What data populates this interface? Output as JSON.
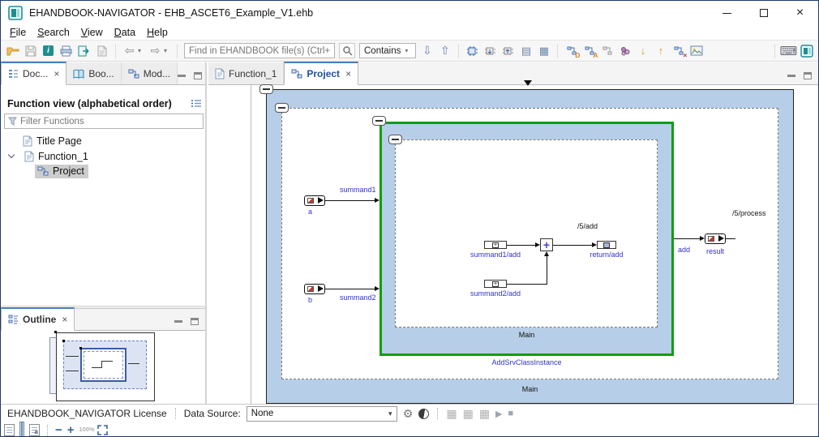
{
  "window": {
    "title": "EHANDBOOK-NAVIGATOR - EHB_ASCET6_Example_V1.ehb"
  },
  "menu": {
    "items": [
      "File",
      "Search",
      "View",
      "Data",
      "Help"
    ]
  },
  "toolbar": {
    "find_placeholder": "Find in EHANDBOOK file(s) (Ctrl+H)",
    "contains_label": "Contains"
  },
  "left_panel": {
    "tabs": [
      {
        "label": "Doc..."
      },
      {
        "label": "Boo..."
      },
      {
        "label": "Mod..."
      }
    ],
    "header": "Function view (alphabetical order)",
    "filter_placeholder": "Filter Functions",
    "tree": [
      {
        "label": "Title Page"
      },
      {
        "label": "Function_1"
      },
      {
        "label": "Project"
      }
    ]
  },
  "outline": {
    "title": "Outline"
  },
  "editor": {
    "tabs": [
      {
        "label": "Function_1"
      },
      {
        "label": "Project"
      }
    ]
  },
  "diagram": {
    "outer_main": "Main",
    "instance": "AddSrvClassInstance",
    "inner_main": "Main",
    "inputs": [
      {
        "name": "a",
        "signal": "summand1"
      },
      {
        "name": "b",
        "signal": "summand2"
      }
    ],
    "ports": [
      "summand1/add",
      "summand2/add",
      "return/add"
    ],
    "operator": "+",
    "add_path": "/5/add",
    "process_path": "/5/process",
    "out_signal": "add",
    "out_name": "result"
  },
  "statusbar": {
    "license": "EHANDBOOK_NAVIGATOR License",
    "data_source_label": "Data Source:",
    "data_source_value": "None"
  },
  "icons": {
    "dropdown": "▾",
    "close": "×",
    "nav_back": "⇦",
    "nav_forward": "⇨",
    "arrow_down": "⇩",
    "arrow_up": "⇧",
    "list": "▤",
    "table": "▦",
    "grid_window": "▦",
    "move_down": "↓",
    "move_up": "↑",
    "gear": "⚙",
    "keyboard": "⌨",
    "play": "▶",
    "stop": "■",
    "minus": "−",
    "plus": "+",
    "zoom_reset": "100%",
    "overlay_d": "D",
    "overlay_a": "A",
    "overlay_x": "×",
    "info": "i",
    "page_a": "a"
  },
  "colors": {
    "diagram_fill": "#b7cee8",
    "diagram_green": "#0ca00c",
    "label_blue": "#3232cc",
    "accent": "#3465a4",
    "teal": "#1f8e8e"
  }
}
